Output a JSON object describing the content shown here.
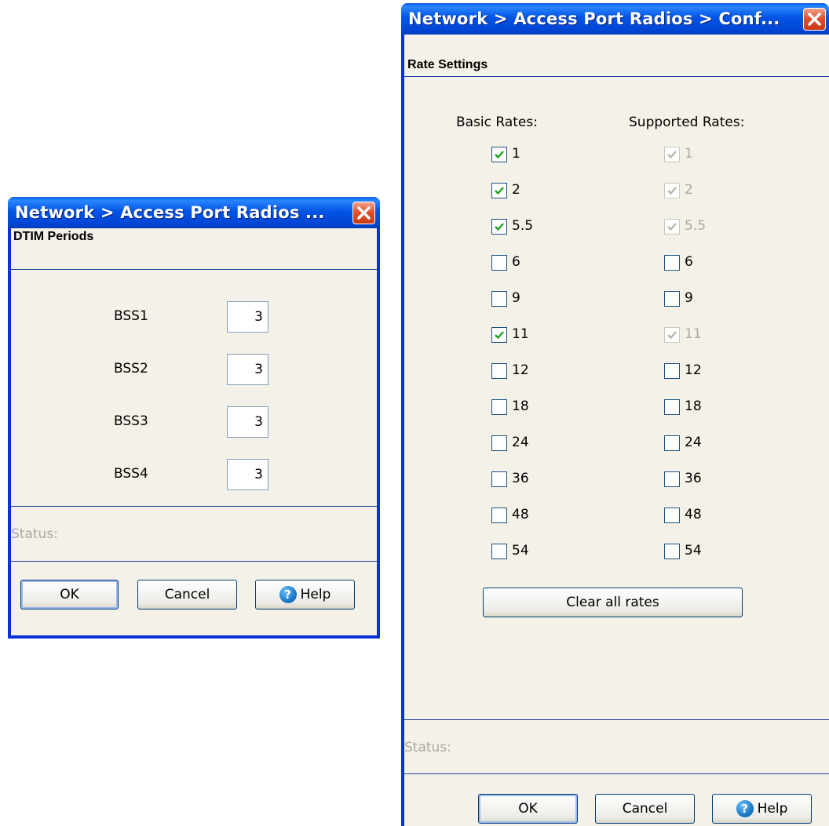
{
  "dtim_window": {
    "title": "Network > Access Port Radios ...",
    "section_title": "DTIM Periods",
    "fields": [
      {
        "label": "BSS1",
        "value": "3"
      },
      {
        "label": "BSS2",
        "value": "3"
      },
      {
        "label": "BSS3",
        "value": "3"
      },
      {
        "label": "BSS4",
        "value": "3"
      }
    ],
    "status_label": "Status:",
    "ok_label": "OK",
    "cancel_label": "Cancel",
    "help_label": "Help"
  },
  "rate_window": {
    "title": "Network > Access Port Radios > Conf...",
    "section_title": "Rate Settings",
    "basic_header": "Basic Rates:",
    "supported_header": "Supported Rates:",
    "rates": [
      {
        "label": "1",
        "basic": true,
        "supported": true,
        "supported_disabled": true
      },
      {
        "label": "2",
        "basic": true,
        "supported": true,
        "supported_disabled": true
      },
      {
        "label": "5.5",
        "basic": true,
        "supported": true,
        "supported_disabled": true
      },
      {
        "label": "6",
        "basic": false,
        "supported": false,
        "supported_disabled": false
      },
      {
        "label": "9",
        "basic": false,
        "supported": false,
        "supported_disabled": false
      },
      {
        "label": "11",
        "basic": true,
        "supported": true,
        "supported_disabled": true
      },
      {
        "label": "12",
        "basic": false,
        "supported": false,
        "supported_disabled": false
      },
      {
        "label": "18",
        "basic": false,
        "supported": false,
        "supported_disabled": false
      },
      {
        "label": "24",
        "basic": false,
        "supported": false,
        "supported_disabled": false
      },
      {
        "label": "36",
        "basic": false,
        "supported": false,
        "supported_disabled": false
      },
      {
        "label": "48",
        "basic": false,
        "supported": false,
        "supported_disabled": false
      },
      {
        "label": "54",
        "basic": false,
        "supported": false,
        "supported_disabled": false
      }
    ],
    "clear_label": "Clear all rates",
    "status_label": "Status:",
    "ok_label": "OK",
    "cancel_label": "Cancel",
    "help_label": "Help"
  },
  "icons": {
    "close": "close-x-icon",
    "help": "question-mark-icon",
    "check": "checkmark-icon"
  },
  "colors": {
    "titlebar": "#0454e3",
    "close": "#e0532f",
    "check": "#21a121",
    "check_disabled": "#b8b6ab"
  }
}
